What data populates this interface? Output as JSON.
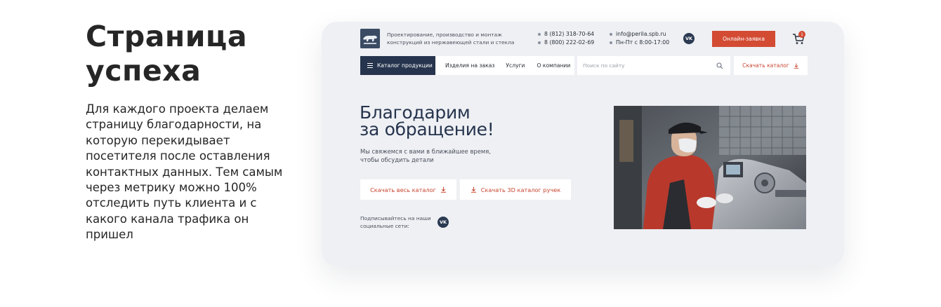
{
  "left": {
    "title": "Страница успеха",
    "description": "Для каждого проекта делаем страницу благодарности, на которую перекидывает посетителя после оставления контактных данных. Тем самым через метрику можно 100% отследить путь клиента и с какого канала трафика он пришел"
  },
  "header": {
    "logo_icon": "bear-logo-icon",
    "tagline": "Проектирование, производство и монтаж конструкций из нержавеющей стали и стекла",
    "phone1": "8 (812) 318-70-64",
    "phone2": "8 (800) 222-02-69",
    "email": "info@perila.spb.ru",
    "hours": "Пн-Пт с 8:00-17:00",
    "vk_label": "VK",
    "order_button": "Онлайн-заявка",
    "cart_count": "1"
  },
  "nav": {
    "catalog_label": "Каталог продукции",
    "items": [
      "Изделия на заказ",
      "Услуги",
      "О компании"
    ],
    "search_placeholder": "Поиск по сайту",
    "download_catalog": "Скачать каталог"
  },
  "hero": {
    "title_line1": "Благодарим",
    "title_line2": "за обращение!",
    "subtitle": "Мы свяжемся с вами в ближайшее время, чтобы обсудить детали",
    "btn_full_catalog": "Скачать весь каталог",
    "btn_3d_catalog": "Скачать 3D каталог ручек",
    "social_text": "Подписывайтесь на наши социальные сети:",
    "vk_label": "VK",
    "photo": "worker-at-machine-photo"
  },
  "colors": {
    "accent": "#d34b33",
    "navy": "#26344d",
    "card_bg": "#eef0f4"
  }
}
